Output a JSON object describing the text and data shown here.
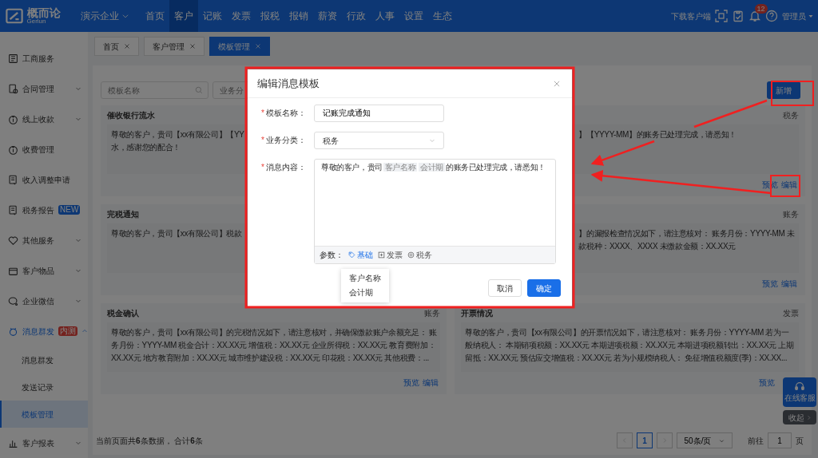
{
  "header": {
    "logo_name": "概而论",
    "logo_sub": "Gerlun",
    "company": "演示企业",
    "nav": [
      {
        "label": "首页",
        "selected": false
      },
      {
        "label": "客户",
        "selected": true
      },
      {
        "label": "记账",
        "selected": false
      },
      {
        "label": "发票",
        "selected": false
      },
      {
        "label": "报税",
        "selected": false
      },
      {
        "label": "报销",
        "selected": false
      },
      {
        "label": "薪资",
        "selected": false
      },
      {
        "label": "行政",
        "selected": false
      },
      {
        "label": "人事",
        "selected": false
      },
      {
        "label": "设置",
        "selected": false
      },
      {
        "label": "生态",
        "selected": false
      }
    ],
    "download": "下载客户端",
    "notifications": "12",
    "user": "管理员"
  },
  "sidebar": {
    "items": [
      {
        "label": "工商服务"
      },
      {
        "label": "合同管理",
        "expanded": false
      },
      {
        "label": "线上收款",
        "expanded": false
      },
      {
        "label": "收费管理"
      },
      {
        "label": "收入调整申请"
      },
      {
        "label": "税务报告",
        "badge": {
          "text": "NEW",
          "kind": "info"
        }
      },
      {
        "label": "其他服务",
        "expanded": false
      },
      {
        "label": "客户物品",
        "expanded": false
      },
      {
        "label": "企业微信",
        "expanded": false
      },
      {
        "label": "消息群发",
        "badge": {
          "text": "内测",
          "kind": "danger"
        },
        "expanded": true,
        "children": [
          {
            "label": "消息群发",
            "selected": false
          },
          {
            "label": "发送记录",
            "selected": false
          },
          {
            "label": "模板管理",
            "selected": true
          }
        ]
      },
      {
        "label": "客户报表",
        "expanded": false
      }
    ]
  },
  "tabs": [
    {
      "label": "首页",
      "selected": false
    },
    {
      "label": "客户管理",
      "selected": false
    },
    {
      "label": "模板管理",
      "selected": true
    }
  ],
  "filters": {
    "name_placeholder": "模板名称",
    "category_placeholder": "业务分"
  },
  "add_button": "新增",
  "cards": [
    {
      "title": "催收银行流水",
      "lines": [
        "尊敬的客户，贵司【xx有限公司】【YY",
        "水，感谢您的配合！"
      ]
    },
    {
      "tag": "税务",
      "lines": [
        "】【YYYY-MM】的账务已处理完成，请悉知！"
      ],
      "actions": [
        "预览",
        "编辑"
      ]
    },
    {
      "title": "完税通知",
      "lines": [
        "尊敬的客户，贵司【xx有限公司】税款"
      ]
    },
    {
      "tag": "账务",
      "lines": [
        "】的漏报检查情况如下，请注意核对：  账务月份：YYYY-MM 未",
        "款税种：XXXX、XXXX 未缴款金额：XX.XX元"
      ],
      "actions": [
        "预览",
        "编辑"
      ]
    },
    {
      "title": "税金确认",
      "tag": "账务",
      "lines": [
        "尊敬的客户，贵司【xx有限公司】的完税情况如下，请注意核对，并确保缴款账户余额充足： 账",
        "务月份：YYYY-MM 税金合计：XX.XX元 增值税：XX.XX元 企业所得税：XX.XX元 教育费附加：",
        "XX.XX元 地方教育附加：XX.XX元 城市维护建设税：XX.XX元 印花税：XX.XX元 其他税费：..."
      ],
      "actions": [
        "预览",
        "编辑"
      ]
    },
    {
      "title": "开票情况",
      "tag": "发票",
      "lines": [
        "尊敬的客户，贵司【xx有限公司】的开票情况如下，请注意核对： 账务月份：YYYY-MM 若为一",
        "般纳税人： 本期销项税额：XX.XX元 本期进项税额：XX.XX元 本期进项税额转出：XX.XX元 上期",
        "留抵：XX.XX元 预估应交增值税：XX.XX元 若为小规模纳税人： 免征增值税额度(季)：XX.XX..."
      ],
      "actions": [
        "预览"
      ]
    }
  ],
  "footer": {
    "summary": "当前页面共**6**条数据， 合计**6**条"
  },
  "pagination": {
    "pages": [
      {
        "label": "1",
        "selected": true
      }
    ],
    "page_size": "50条/页",
    "goto_label": "前往",
    "goto_value": "1",
    "page_unit": "页"
  },
  "float": {
    "service": "在线客服",
    "collapse": "收起"
  },
  "modal": {
    "title": "编辑消息模板",
    "fields": [
      {
        "kind": "input",
        "label": "模板名称：",
        "value": "记账完成通知",
        "required_mark": "*"
      },
      {
        "kind": "select",
        "label": "业务分类：",
        "value": "税务",
        "required_mark": "*"
      },
      {
        "kind": "content",
        "label": "消息内容：",
        "required_mark": "*",
        "segments": [
          {
            "kind": "text",
            "text": "尊敬的客户，贵司"
          },
          {
            "kind": "tag",
            "text": "客户名称"
          },
          {
            "kind": "tag",
            "text": "会计期"
          },
          {
            "kind": "text",
            "text": "的账务已处理完成，请悉知！"
          }
        ]
      }
    ],
    "params_label": "参数：",
    "param_tabs": [
      {
        "label": "基础",
        "selected": true
      },
      {
        "label": "发票",
        "selected": false
      },
      {
        "label": "税务",
        "selected": false
      }
    ],
    "param_options": [
      "客户名称",
      "会计期"
    ],
    "buttons": [
      {
        "kind": "default",
        "label": "取消"
      },
      {
        "kind": "primary",
        "label": "确定"
      }
    ]
  }
}
